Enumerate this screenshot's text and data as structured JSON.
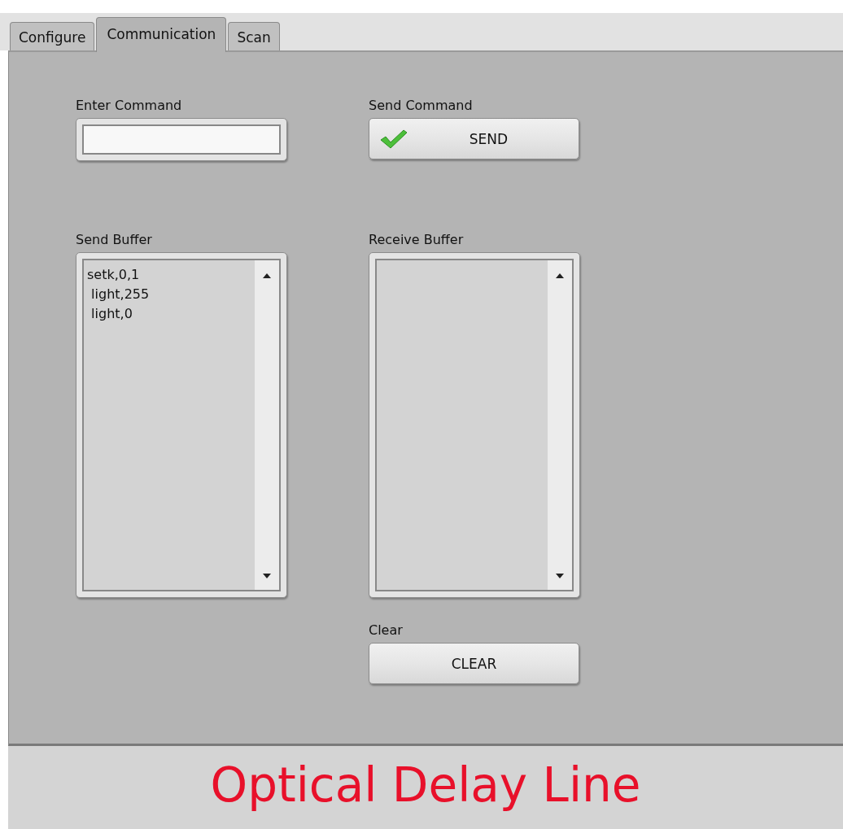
{
  "tabs": [
    {
      "label": "Configure",
      "selected": false
    },
    {
      "label": "Communication",
      "selected": true
    },
    {
      "label": "Scan",
      "selected": false
    }
  ],
  "enter_command": {
    "label": "Enter Command"
  },
  "send_command": {
    "label": "Send Command",
    "button": "SEND"
  },
  "send_buffer": {
    "label": "Send Buffer",
    "lines": [
      "setk,0,1",
      " light,255",
      " light,0"
    ]
  },
  "receive_buffer": {
    "label": "Receive Buffer"
  },
  "clear": {
    "label": "Clear",
    "button": "CLEAR"
  },
  "footer": {
    "title": "Optical Delay Line"
  }
}
